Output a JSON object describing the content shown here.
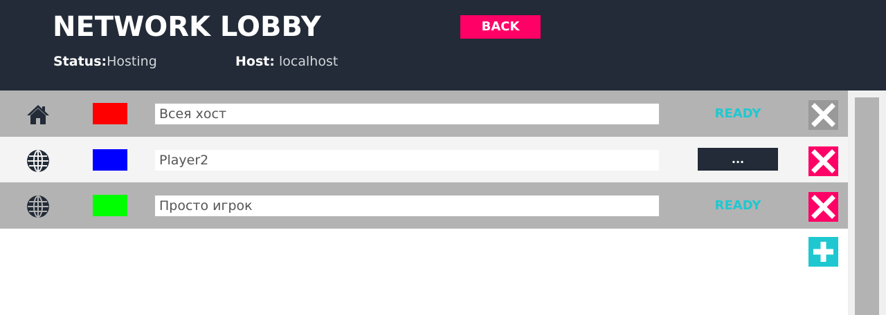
{
  "header": {
    "title": "NETWORK LOBBY",
    "back_label": "BACK",
    "status_label": "Status:",
    "status_value": "Hosting",
    "host_label": "Host:",
    "host_value": "localhost"
  },
  "players": [
    {
      "icon": "home-icon",
      "color": "#ff0000",
      "name": "Всея хост",
      "state": "READY",
      "remove_enabled": false
    },
    {
      "icon": "globe-icon",
      "color": "#0000ff",
      "name": "Player2",
      "state": "...",
      "remove_enabled": true
    },
    {
      "icon": "globe-icon",
      "color": "#00ff00",
      "name": "Просто игрок",
      "state": "READY",
      "remove_enabled": true
    }
  ],
  "colors": {
    "header_bg": "#222b37",
    "accent_pink": "#ff0066",
    "accent_cyan": "#1fc8d0",
    "row_gray": "#b3b3b3",
    "disabled_remove": "#999999"
  }
}
